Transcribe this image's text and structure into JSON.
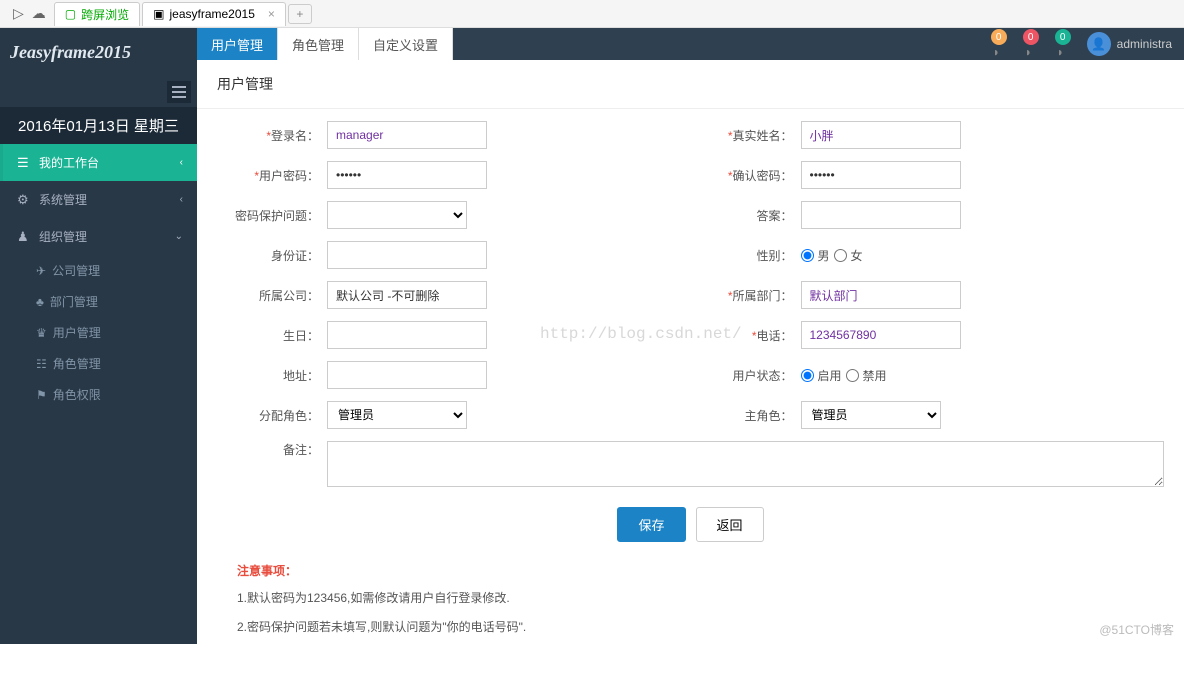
{
  "browser": {
    "tab1": "跨屏浏览",
    "tab2": "jeasyframe2015",
    "close": "×",
    "add": "+"
  },
  "sidebar": {
    "logo": "Jeasyframe2015",
    "date": "2016年01月13日 星期三",
    "nav": {
      "workbench": "我的工作台",
      "system": "系统管理",
      "org": "组织管理",
      "sub_company": "公司管理",
      "sub_dept": "部门管理",
      "sub_user": "用户管理",
      "sub_role": "角色管理",
      "sub_perm": "角色权限"
    }
  },
  "topbar": {
    "tab_user": "用户管理",
    "tab_role": "角色管理",
    "tab_custom": "自定义设置",
    "badge1": "0",
    "badge2": "0",
    "badge3": "0",
    "username": "administra"
  },
  "page": {
    "title": "用户管理",
    "labels": {
      "login": "登录名：",
      "realname": "真实姓名：",
      "password": "用户密码：",
      "confirm": "确认密码：",
      "question": "密码保护问题：",
      "answer": "答案：",
      "idcard": "身份证：",
      "gender": "性别：",
      "company": "所属公司：",
      "dept": "所属部门：",
      "birthday": "生日：",
      "phone": "电话：",
      "address": "地址：",
      "status": "用户状态：",
      "assign_role": "分配角色：",
      "main_role": "主角色：",
      "remark": "备注："
    },
    "values": {
      "login": "manager",
      "realname": "小胖",
      "password": "••••••",
      "confirm": "••••••",
      "company": "默认公司 -不可删除",
      "dept": "默认部门",
      "phone": "1234567890",
      "assign_role": "管理员",
      "main_role": "管理员"
    },
    "gender": {
      "male": "男",
      "female": "女"
    },
    "status": {
      "enable": "启用",
      "disable": "禁用"
    },
    "buttons": {
      "save": "保存",
      "back": "返回"
    },
    "notes": {
      "title": "注意事项：",
      "n1": "1.默认密码为123456,如需修改请用户自行登录修改.",
      "n2": "2.密码保护问题若未填写,则默认问题为\"你的电话号码\"."
    }
  },
  "watermark": "http://blog.csdn.net/",
  "cto": "@51CTO博客"
}
